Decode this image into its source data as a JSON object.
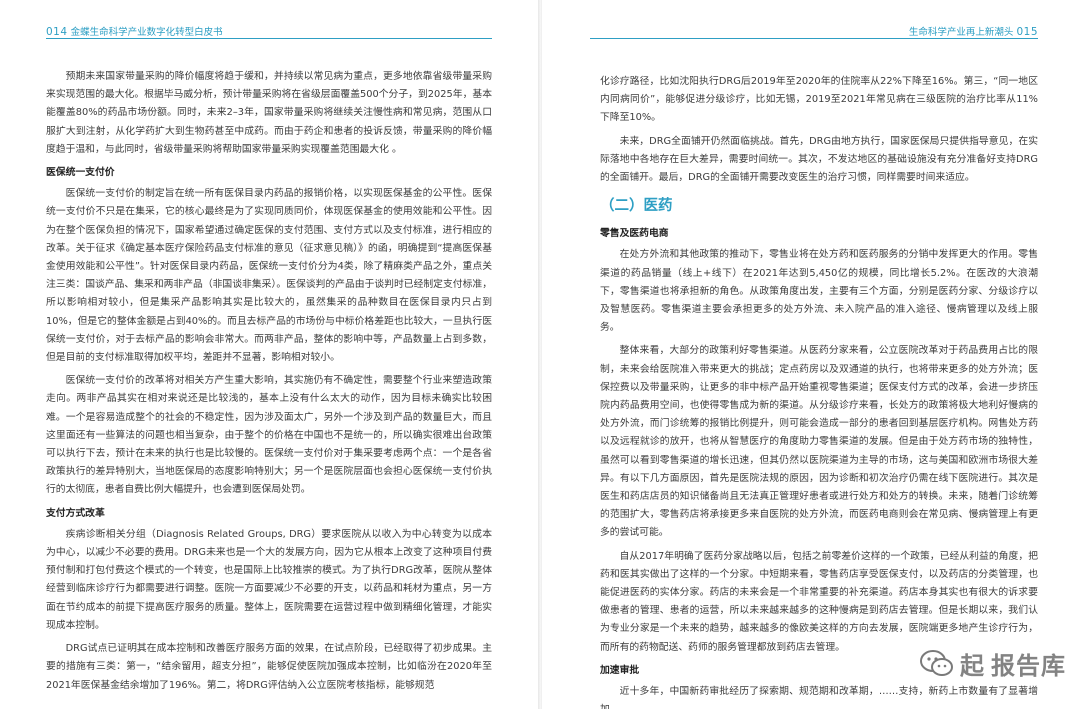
{
  "left_page": {
    "page_number": "014",
    "header_title": "金蝶生命科学产业数字化转型白皮书",
    "paragraphs": [
      "预期未来国家带量采购的降价幅度将趋于缓和，并持续以常见病为重点，更多地依靠省级带量采购来实现范围的最大化。根据毕马威分析，预计带量采购将在省级层面覆盖500个分子，到2025年，基本能覆盖80%的药品市场份额。同时，未来2–3年，国家带量采购将继续关注慢性病和常见病，范围从口服扩大到注射，从化学药扩大到生物药甚至中成药。而由于药企和患者的投诉反馈，带量采购的降价幅度趋于温和，与此同时，省级带量采购将帮助国家带量采购实现覆盖范围最大化 。"
    ],
    "subheading_1": "医保统一支付价",
    "paragraphs_2": [
      "医保统一支付价的制定旨在统一所有医保目录内药品的报销价格，以实现医保基金的公平性。医保统一支付价不只是在集采，它的核心最终是为了实现同质同价，体现医保基金的使用效能和公平性。因为在整个医保负担的情况下，国家希望通过确定医保的支付范围、支付方式以及支付标准，进行相应的改革。关于征求《确定基本医疗保险药品支付标准的意见（征求意见稿）》的函，明确提到“提高医保基金使用效能和公平性”。针对医保目录内药品，医保统一支付价分为4类，除了精麻类产品之外，重点关注三类：国谈产品、集采和两非产品（非国谈非集采）。医保谈判的产品由于谈判时已经制定支付标准，所以影响相对较小，但是集采产品影响其实是比较大的，虽然集采的品种数目在医保目录内只占到10%，但是它的整体金额是占到40%的。而且去标产品的市场份与中标价格差距也比较大，一旦执行医保统一支付价，对于去标产品的影响会非常大。而两非产品，整体的影响中等，产品数量上占到多数，但是目前的支付标准取得加权平均，差距并不显著，影响相对较小。",
      "医保统一支付价的改革将对相关方产生重大影响，其实施仍有不确定性，需要整个行业来塑造政策走向。两非产品其实在相对来说还是比较浅的，基本上没有什么太大的动作，因为目标未确实比较困难。一个是容易造成整个的社会的不稳定性，因为涉及面太广，另外一个涉及到产品的数量巨大，而且这里面还有一些算法的问题也相当复杂，由于整个的价格在中国也不是统一的，所以确实很难出台政策可以执行下去，预计在未来的执行也是比较慢的。医保统一支付价对于集采要考虑两个点：一个是各省政策执行的差异特别大，当地医保局的态度影响特别大；另一个是医院层面也会担心医保统一支付价执行的太彻底，患者自费比例大幅提升，也会遭到医保局处罚。"
    ],
    "subheading_2": "支付方式改革",
    "paragraphs_3": [
      "疾病诊断相关分组（Diagnosis Related Groups, DRG）要求医院从以收入为中心转变为以成本为中心，以减少不必要的费用。DRG未来也是一个大的发展方向，因为它从根本上改变了这种项目付费预付制和打包付费这个模式的一个转变，也是国际上比较推崇的模式。为了执行DRG改革，医院从整体经营到临床诊疗行为都需要进行调整。医院一方面要减少不必要的开支，以药品和耗材为重点，另一方面在节约成本的前提下提高医疗服务的质量。整体上，医院需要在运营过程中做到精细化管理，才能实现成本控制。",
      "DRG试点已证明其在成本控制和改善医疗服务方面的效果，在试点阶段，已经取得了初步成果。主要的措施有三类：第一，“结余留用，超支分担”，能够促使医院加强成本控制，比如临汾在2020年至2021年医保基金结余增加了196%。第二，将DRG评估纳入公立医院考核指标，能够规范"
    ]
  },
  "right_page": {
    "page_number": "015",
    "header_title": "生命科学产业再上新潮头",
    "paragraphs": [
      "化诊疗路径，比如沈阳执行DRG后2019年至2020年的住院率从22%下降至16%。第三，“同一地区内同病同价”，能够促进分级诊疗，比如无锡，2019至2021年常见病在三级医院的治疗比率从11%下降至10%。",
      "未来，DRG全面铺开仍然面临挑战。首先，DRG由地方执行，国家医保局只提供指导意见，在实际落地中各地存在巨大差异，需要时间统一。其次，不发达地区的基础设施没有充分准备好支持DRG的全面铺开。最后，DRG的全面铺开需要改变医生的治疗习惯，同样需要时间来适应。"
    ],
    "section_title": "（二）医药",
    "subheading_1": "零售及医药电商",
    "paragraphs_2": [
      "在处方外流和其他政策的推动下，零售业将在处方药和医药服务的分销中发挥更大的作用。零售渠道的药品销量（线上+线下）在2021年达到5,450亿的规模，同比增长5.2%。在医改的大浪潮下，零售渠道也将承担新的角色。从政策角度出发，主要有三个方面，分别是医药分家、分级诊疗以及智慧医药。零售渠道主要会承担更多的处方外流、未入院产品的准入途径、慢病管理以及线上服务。",
      "整体来看，大部分的政策利好零售渠道。从医药分家来看，公立医院改革对于药品费用占比的限制，未来会给医院准入带来更大的挑战；定点药房以及双通道的执行，也将带来更多的处方外流；医保控费以及带量采购，让更多的非中标产品开始重视零售渠道；医保支付方式的改革，会进一步挤压院内药品费用空间，也使得零售成为新的渠道。从分级诊疗来看，长处方的政策将极大地利好慢病的处方外流，而门诊统筹的报销比例提升，则可能会造成一部分的患者回到基层医疗机构。网售处方药以及远程就诊的放开，也将从智慧医疗的角度助力零售渠道的发展。但是由于处方药市场的独特性，虽然可以看到零售渠道的增长迅速，但其仍然以医院渠道为主导的市场，这与美国和欧洲市场很大差异。有以下几方面原因，首先是医院法规的原因，因为诊断和初次治疗仍需在线下医院进行。其次是医生和药店店员的知识储备尚且无法真正管理好患者或进行处方和处方的转换。未来，随着门诊统筹的范围扩大，零售药店将承接更多来自医院的处方外流，而医药电商则会在常见病、慢病管理上有更多的尝试可能。",
      "自从2017年明确了医药分家战略以后，包括之前零差价这样的一个政策，已经从利益的角度，把药和医其实做出了这样的一个分家。中短期来看，零售药店享受医保支付，以及药店的分类管理，也能促进医药的实体分家。药店的未来会是一个非常重要的补充渠道。药店本身其实也有很大的诉求要做患者的管理、患者的运营，所以未来越来越多的这种慢病是到药店去管理。但是长期以来，我们认为专业分家是一个未来的趋势，越来越多的像欧美这样的方向去发展，医院端更多地产生诊疗行为，而所有的药物配送、药师的服务管理都放到药店去管理。"
    ],
    "subheading_2": "加速审批",
    "paragraphs_3": [
      "近十多年，中国新药审批经历了探索期、规范期和改革期，……支持，新药上市数量有了显著增加。"
    ]
  },
  "watermark": {
    "text": "报告库",
    "partial_prefix": "起 ",
    "icon": "wechat-icon",
    "color": "#6e6e6e"
  },
  "colors": {
    "accent": "#2e9fc4",
    "text": "#3c3c3c"
  }
}
